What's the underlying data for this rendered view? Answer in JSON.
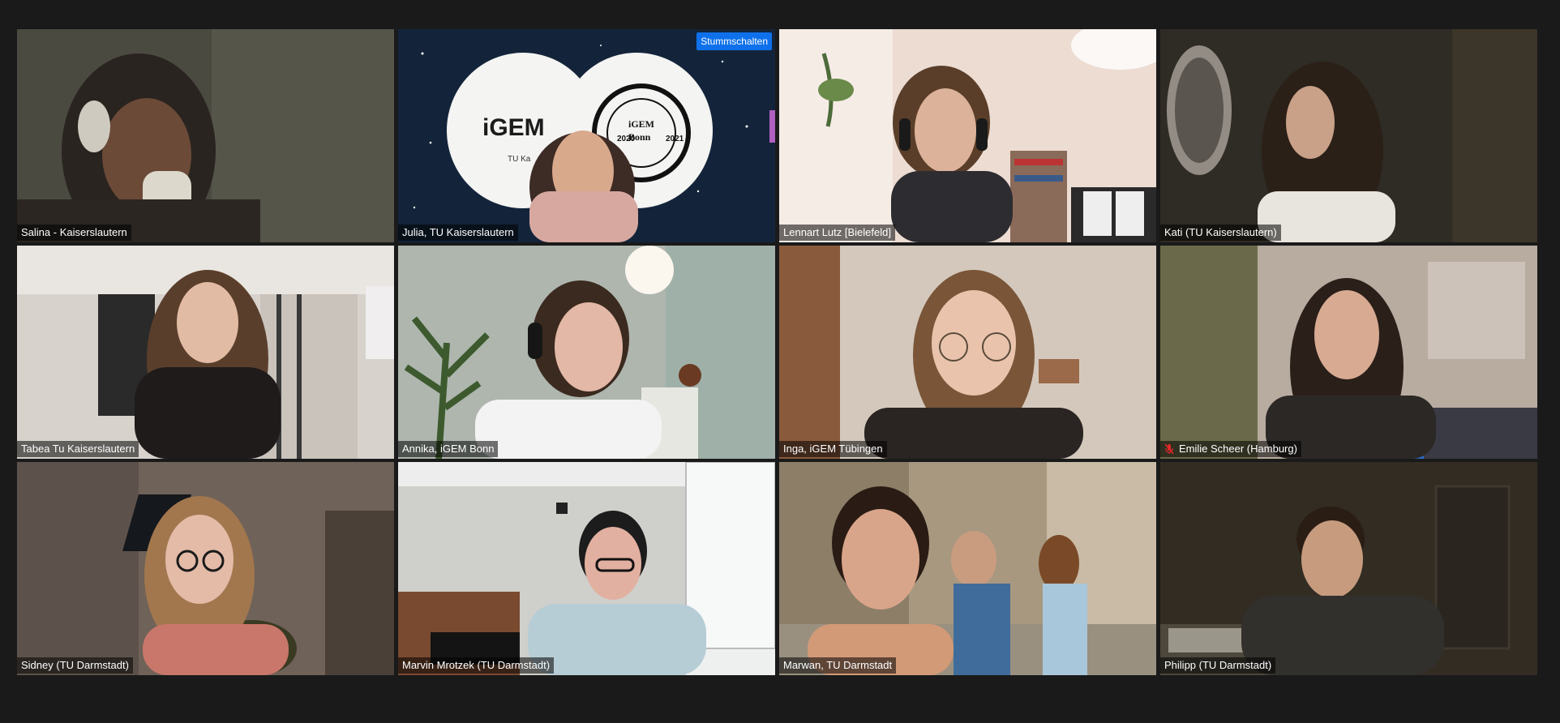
{
  "meeting": {
    "mute_button_label": "Stummschalten",
    "active_speaker_color": "#d6e463",
    "mute_button_color": "#0e71eb"
  },
  "participants": [
    {
      "name": "Salina - Kaiserslautern",
      "muted": false
    },
    {
      "name": "Julia, TU Kaiserslautern",
      "muted": false,
      "background": "iGEM Bonn / TU Kaiserslautern logos"
    },
    {
      "name": "Lennart Lutz [Bielefeld]",
      "muted": false,
      "active_speaker": true
    },
    {
      "name": "Kati (TU Kaiserslautern)",
      "muted": false
    },
    {
      "name": "Tabea Tu Kaiserslautern",
      "muted": false
    },
    {
      "name": "Annika, iGEM Bonn",
      "muted": false
    },
    {
      "name": "Inga, iGEM Tübingen",
      "muted": false
    },
    {
      "name": "Emilie Scheer (Hamburg)",
      "muted": true
    },
    {
      "name": "Sidney (TU Darmstadt)",
      "muted": false
    },
    {
      "name": "Marvin Mrotzek (TU Darmstadt)",
      "muted": false
    },
    {
      "name": "Marwan, TU Darmstadt",
      "muted": false
    },
    {
      "name": "Philipp (TU Darmstadt)",
      "muted": false
    }
  ],
  "background_logos": {
    "left_logo_text": "iGEM",
    "left_logo_subtext": "TU Ka",
    "right_logo_text": "iGEM",
    "right_logo_city": "Bonn",
    "right_logo_year_left": "2020",
    "right_logo_year_right": "2021"
  }
}
